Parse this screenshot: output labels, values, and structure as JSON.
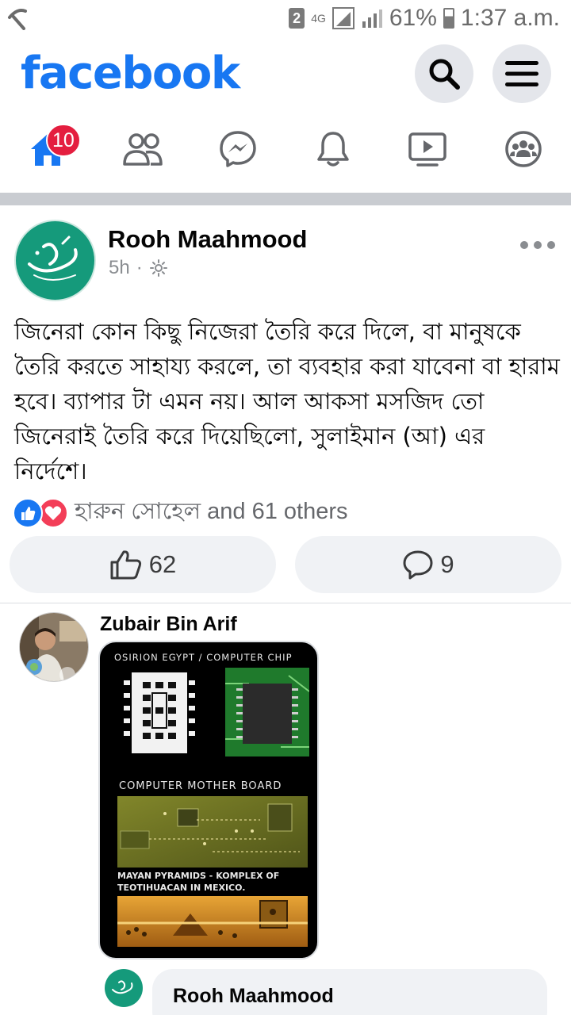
{
  "status_bar": {
    "sim_badge": "2",
    "network": "4G",
    "battery": "61%",
    "time": "1:37 a.m."
  },
  "header": {
    "logo": "facebook"
  },
  "nav": {
    "home_badge": "10"
  },
  "post": {
    "author": "Rooh Maahmood",
    "time": "5h",
    "separator": "·",
    "text": "জিনেরা কোন কিছু নিজেরা তৈরি করে দিলে, বা মানুষকে তৈরি করতে সাহায্য করলে, তা ব্যবহার করা যাবেনা বা হারাম হবে। ব্যাপার টা এমন নয়। আল আকসা মসজিদ তো জিনেরাই তৈরি করে দিয়েছিলো, সুলাইমান (আ) এর নির্দেশে।",
    "reactions_text": "হারুন সোহেল and 61 others",
    "like_count": "62",
    "comment_count": "9"
  },
  "comment": {
    "author": "Zubair Bin Arif",
    "image_captions": {
      "top": "OSIRION EGYPT / COMPUTER CHIP",
      "middle": "COMPUTER MOTHER BOARD",
      "bottom_line1": "MAYAN PYRAMIDS - KOMPLEX OF",
      "bottom_line2": "TEOTIHUACAN IN MEXICO."
    }
  },
  "reply": {
    "author": "Rooh Maahmood"
  }
}
